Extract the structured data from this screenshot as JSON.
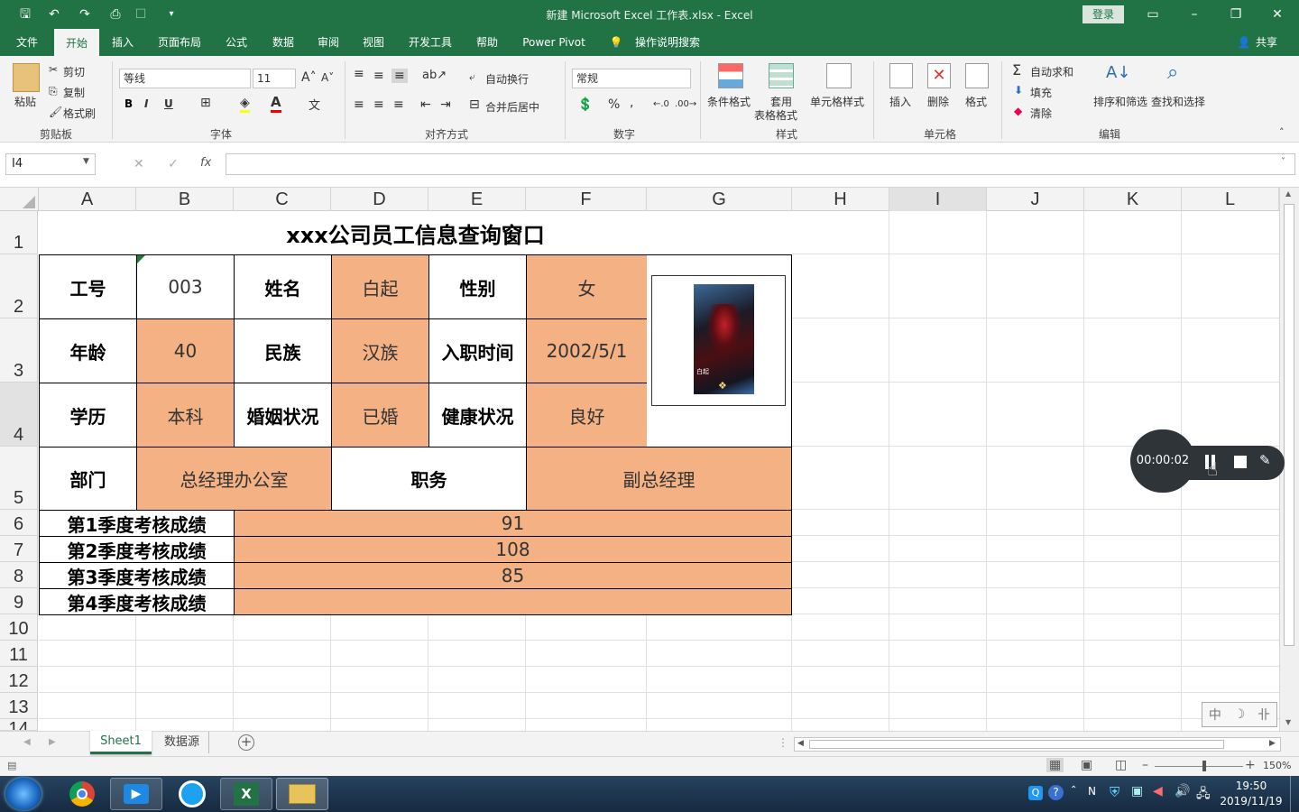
{
  "window": {
    "title": "新建 Microsoft Excel 工作表.xlsx  -  Excel",
    "login_label": "登录",
    "share_label": "共享"
  },
  "tabs": [
    "文件",
    "开始",
    "插入",
    "页面布局",
    "公式",
    "数据",
    "审阅",
    "视图",
    "开发工具",
    "帮助",
    "Power Pivot"
  ],
  "tell_me": "操作说明搜索",
  "ribbon": {
    "clipboard": {
      "paste": "粘贴",
      "cut": "剪切",
      "copy": "复制",
      "format_painter": "格式刷",
      "group": "剪贴板"
    },
    "font": {
      "name": "等线",
      "size": "11",
      "bold": "B",
      "italic": "I",
      "underline": "U",
      "group": "字体"
    },
    "alignment": {
      "wrap": "自动换行",
      "merge": "合并后居中",
      "group": "对齐方式"
    },
    "number": {
      "format": "常规",
      "percent": "%",
      "comma": ",",
      "group": "数字"
    },
    "styles": {
      "conditional": "条件格式",
      "table_line1": "套用",
      "table_line2": "表格格式",
      "cell_styles": "单元格样式",
      "group": "样式"
    },
    "cells": {
      "insert": "插入",
      "delete": "删除",
      "format": "格式",
      "group": "单元格"
    },
    "editing": {
      "autosum": "自动求和",
      "fill": "填充",
      "clear": "清除",
      "sort": "排序和筛选",
      "find": "查找和选择",
      "group": "编辑"
    }
  },
  "formula_bar": {
    "name_box": "I4",
    "fx": "fx",
    "value": ""
  },
  "columns": [
    "A",
    "B",
    "C",
    "D",
    "E",
    "F",
    "G",
    "H",
    "I",
    "J",
    "K",
    "L"
  ],
  "rows": [
    "1",
    "2",
    "3",
    "4",
    "5",
    "6",
    "7",
    "8",
    "9",
    "10",
    "11",
    "12",
    "13",
    "14"
  ],
  "sheet": {
    "title": "xxx公司员工信息查询窗口",
    "r2": {
      "id_label": "工号",
      "id": "003",
      "name_label": "姓名",
      "name": "白起",
      "gender_label": "性别",
      "gender": "女"
    },
    "r3": {
      "age_label": "年龄",
      "age": "40",
      "ethnic_label": "民族",
      "ethnic": "汉族",
      "hire_label": "入职时间",
      "hire": "2002/5/1"
    },
    "r4": {
      "edu_label": "学历",
      "edu": "本科",
      "marital_label": "婚姻状况",
      "marital": "已婚",
      "health_label": "健康状况",
      "health": "良好"
    },
    "r5": {
      "dept_label": "部门",
      "dept": "总经理办公室",
      "post_label": "职务",
      "post": "副总经理"
    },
    "scores": [
      {
        "label": "第1季度考核成绩",
        "value": "91"
      },
      {
        "label": "第2季度考核成绩",
        "value": "108"
      },
      {
        "label": "第3季度考核成绩",
        "value": "85"
      },
      {
        "label": "第4季度考核成绩",
        "value": ""
      }
    ],
    "photo_caption": "白起"
  },
  "sheet_tabs": [
    "Sheet1",
    "数据源"
  ],
  "recorder": {
    "time": "00:00:02"
  },
  "ime": [
    "中",
    "☽",
    "卝"
  ],
  "status": {
    "zoom": "150%"
  },
  "taskbar": {
    "time": "19:50",
    "date": "2019/11/19"
  },
  "colors": {
    "excel_green": "#217346",
    "highlight": "#f4b183"
  }
}
